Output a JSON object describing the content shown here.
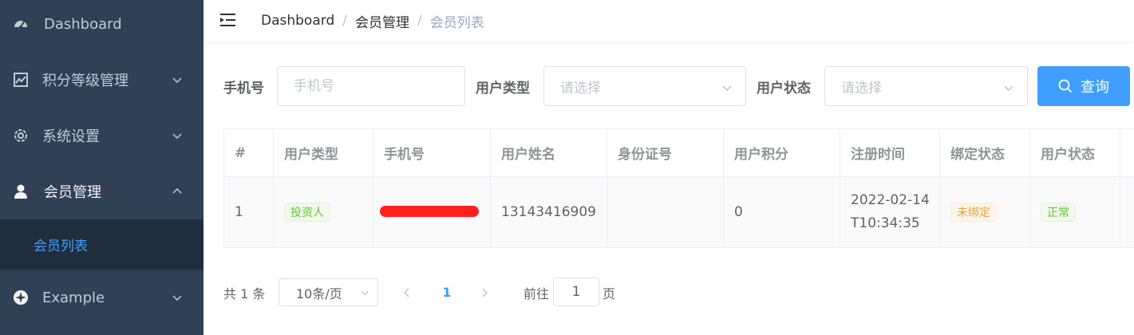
{
  "sidebar": {
    "items": [
      {
        "label": "Dashboard",
        "icon": "dashboard-icon"
      },
      {
        "label": "积分等级管理",
        "icon": "chart-icon"
      },
      {
        "label": "系统设置",
        "icon": "gear-icon"
      },
      {
        "label": "会员管理",
        "icon": "user-icon"
      },
      {
        "label": "Example",
        "icon": "example-icon"
      }
    ],
    "submenu": {
      "label": "会员列表"
    }
  },
  "breadcrumb": {
    "items": [
      "Dashboard",
      "会员管理",
      "会员列表"
    ]
  },
  "filters": {
    "phone_label": "手机号",
    "phone_placeholder": "手机号",
    "type_label": "用户类型",
    "type_placeholder": "请选择",
    "status_label": "用户状态",
    "status_placeholder": "请选择",
    "search_label": "查询"
  },
  "table": {
    "headers": [
      "#",
      "用户类型",
      "手机号",
      "用户姓名",
      "身份证号",
      "用户积分",
      "注册时间",
      "绑定状态",
      "用户状态"
    ],
    "rows": [
      {
        "index": "1",
        "type": "投资人",
        "phone": "",
        "name": "13143416909",
        "id_card": "",
        "points": "0",
        "reg_date": "2022-02-14",
        "reg_time": "T10:34:35",
        "bind_status": "未绑定",
        "user_status": "正常"
      }
    ]
  },
  "pagination": {
    "total": "共 1 条",
    "page_size": "10条/页",
    "current": "1",
    "goto_label": "前往",
    "goto_value": "1",
    "page_suffix": "页"
  },
  "colors": {
    "accent": "#409eff",
    "sidebar": "#304156",
    "submenu": "#1f2d3d"
  }
}
